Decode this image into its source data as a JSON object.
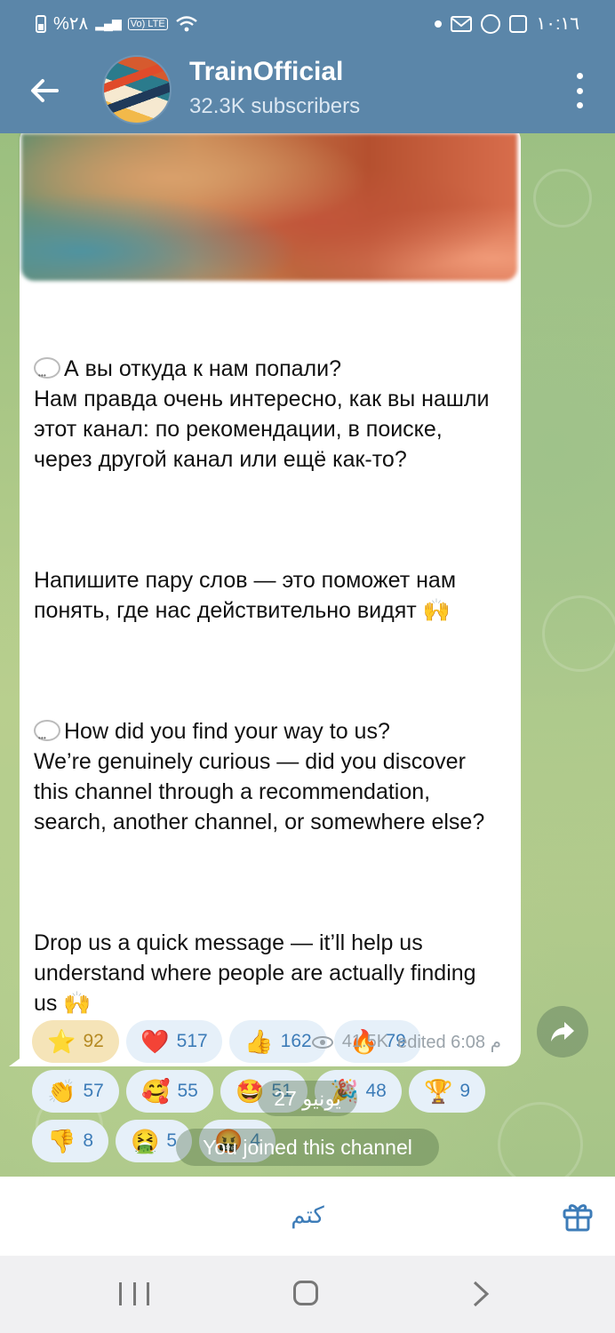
{
  "status_bar": {
    "battery_text": "%٢٨",
    "network_badge": "Vo) LTE",
    "time": "١٠:١٦"
  },
  "header": {
    "title": "TrainOfficial",
    "subtitle": "32.3K subscribers"
  },
  "message": {
    "paragraphs": [
      "А вы откуда к нам попали?\nНам правда очень интересно, как вы нашли этот канал: по рекомендации, в поиске, через другой канал или ещё как-то?",
      "Напишите пару слов — это поможет нам понять, где нас действительно видят 🙌",
      "How did you find your way to us?\nWe’re genuinely curious — did you discover this channel through a recommendation, search, another channel, or somewhere else?",
      "Drop us a quick message — it’ll help us understand where people are actually finding us 🙌"
    ],
    "reactions": [
      {
        "emoji": "⭐",
        "count": "92",
        "active": true
      },
      {
        "emoji": "❤️",
        "count": "517"
      },
      {
        "emoji": "👍",
        "count": "162"
      },
      {
        "emoji": "🔥",
        "count": "79"
      },
      {
        "emoji": "👏",
        "count": "57"
      },
      {
        "emoji": "🥰",
        "count": "55"
      },
      {
        "emoji": "🤩",
        "count": "51"
      },
      {
        "emoji": "🎉",
        "count": "48"
      },
      {
        "emoji": "🏆",
        "count": "9"
      },
      {
        "emoji": "👎",
        "count": "8"
      },
      {
        "emoji": "🤮",
        "count": "5"
      },
      {
        "emoji": "🤬",
        "count": "4"
      }
    ],
    "views": "41.5K",
    "edited_label": "edited 6:08 م"
  },
  "chat": {
    "date_label": "27 يونيو",
    "joined_label": "You joined this channel"
  },
  "bottom_bar": {
    "mute_label": "كتم"
  },
  "icons": {
    "back": "arrow-left-icon",
    "menu": "more-vertical-icon",
    "share": "forward-icon",
    "gift": "gift-icon",
    "views": "eye-icon"
  },
  "colors": {
    "header": "#5b86a9",
    "accent": "#3d7cb8",
    "chip": "#e6f0f9",
    "chip_active": "#f5e4b8"
  }
}
